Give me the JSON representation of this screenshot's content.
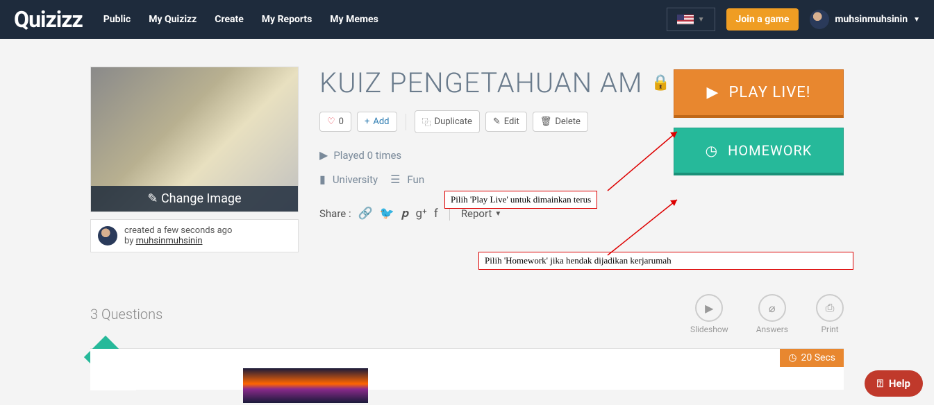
{
  "header": {
    "logo": "Quizizz",
    "nav": [
      "Public",
      "My Quizizz",
      "Create",
      "My Reports",
      "My Memes"
    ],
    "join": "Join a game",
    "username": "muhsinmuhsinin"
  },
  "quiz": {
    "title": "KUIZ PENGETAHUAN AM",
    "likes": "0",
    "add": "Add",
    "duplicate": "Duplicate",
    "edit": "Edit",
    "delete": "Delete",
    "played": "Played 0 times",
    "level": "University",
    "category": "Fun",
    "share_label": "Share :",
    "report": "Report",
    "change_image": "Change Image",
    "created": "created a few seconds ago",
    "by": "by ",
    "author": "muhsinmuhsinin"
  },
  "buttons": {
    "play_live": "PLAY LIVE!",
    "homework": "HOMEWORK"
  },
  "annotations": {
    "play": "Pilih 'Play Live' untuk dimainkan terus",
    "homework": "Pilih 'Homework' jika hendak dijadikan kerjarumah"
  },
  "questions": {
    "count": "3 Questions",
    "slideshow": "Slideshow",
    "answers": "Answers",
    "print": "Print",
    "time": "20 Secs"
  },
  "help": "Help"
}
